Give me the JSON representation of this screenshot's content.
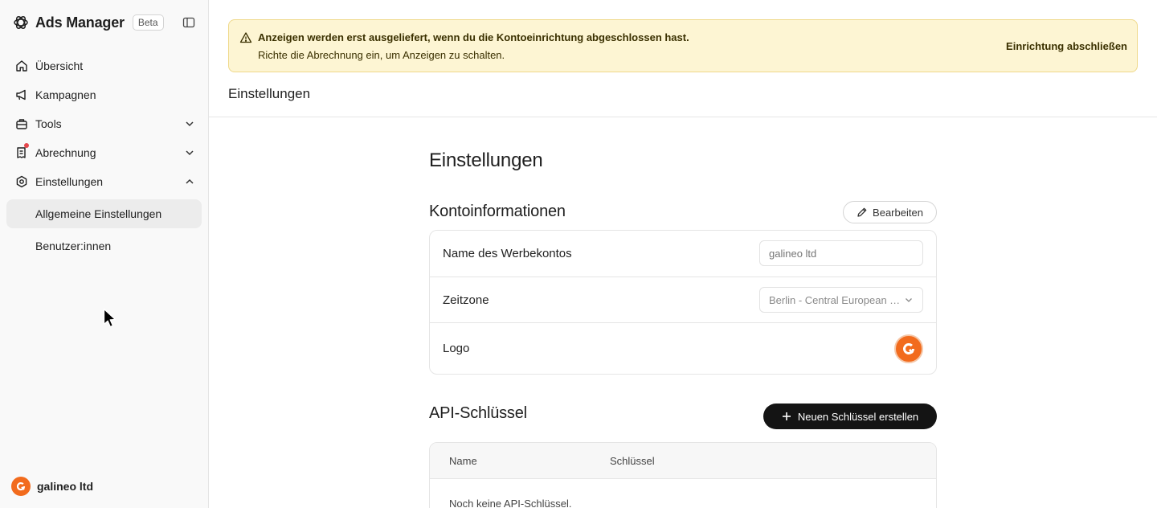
{
  "app": {
    "title": "Ads Manager",
    "badge": "Beta"
  },
  "sidebar": {
    "items": [
      {
        "label": "Übersicht"
      },
      {
        "label": "Kampagnen"
      },
      {
        "label": "Tools"
      },
      {
        "label": "Abrechnung"
      },
      {
        "label": "Einstellungen"
      }
    ],
    "sub_items": [
      {
        "label": "Allgemeine Einstellungen",
        "active": true
      },
      {
        "label": "Benutzer:innen"
      }
    ],
    "account_name": "galineo ltd"
  },
  "banner": {
    "line1": "Anzeigen werden erst ausgeliefert, wenn du die Kontoeinrichtung abgeschlossen hast.",
    "line2": "Richte die Abrechnung ein, um Anzeigen zu schalten.",
    "action": "Einrichtung abschließen"
  },
  "header": {
    "title": "Einstellungen"
  },
  "content": {
    "title": "Einstellungen",
    "account_section": {
      "title": "Kontoinformationen",
      "edit_label": "Bearbeiten",
      "rows": [
        {
          "label": "Name des Werbekontos",
          "placeholder": "galineo ltd"
        },
        {
          "label": "Zeitzone",
          "value": "Berlin - Central European Time"
        },
        {
          "label": "Logo"
        }
      ]
    },
    "api_section": {
      "title": "API-Schlüssel",
      "create_label": "Neuen Schlüssel erstellen",
      "columns": [
        "Name",
        "Schlüssel"
      ],
      "empty_text": "Noch keine API-Schlüssel."
    }
  },
  "colors": {
    "accent": "#141414",
    "banner_bg": "#fdf5d3",
    "logo_orange": "#f26b1d",
    "notification": "#e5484d"
  },
  "icons": [
    "openai-logo-icon",
    "sidebar-toggle-icon",
    "home-icon",
    "megaphone-icon",
    "toolbox-icon",
    "receipt-icon",
    "gear-icon",
    "chevron-down-icon",
    "chevron-up-icon",
    "warning-icon",
    "pencil-icon",
    "plus-icon"
  ]
}
